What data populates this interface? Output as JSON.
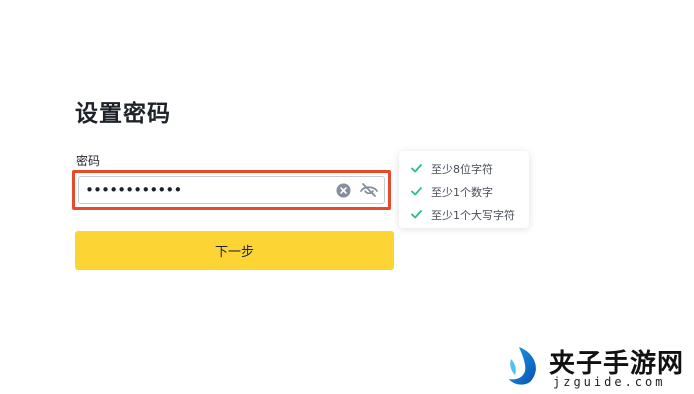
{
  "page": {
    "title": "设置密码"
  },
  "password_field": {
    "label": "密码",
    "value": "••••••••••••",
    "highlight_color": "#e8492a"
  },
  "icons": {
    "clear": "clear-circle-icon",
    "visibility": "eye-off-icon",
    "rule_check": "check-icon"
  },
  "next_button": {
    "label": "下一步",
    "color": "#fcd535"
  },
  "requirements": [
    {
      "label": "至少8位字符",
      "met": true
    },
    {
      "label": "至少1个数字",
      "met": true
    },
    {
      "label": "至少1个大写字符",
      "met": true
    }
  ],
  "check_color": "#2ebd85",
  "watermark": {
    "title": "夹子手游网",
    "url": "jzguide.com"
  }
}
